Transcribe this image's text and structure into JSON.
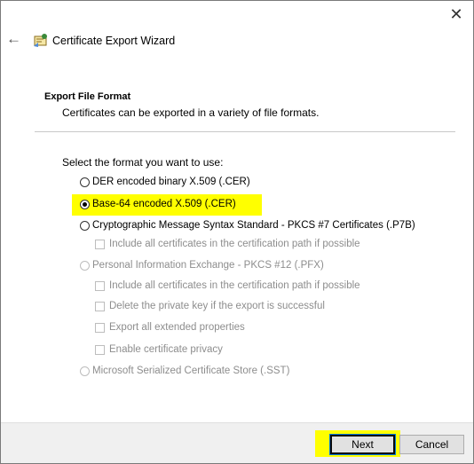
{
  "window": {
    "title": "Certificate Export Wizard"
  },
  "header": {
    "section_title": "Export File Format",
    "section_subtitle": "Certificates can be exported in a variety of file formats."
  },
  "form": {
    "prompt": "Select the format you want to use:",
    "options": [
      {
        "label": "DER encoded binary X.509 (.CER)",
        "type": "radio",
        "checked": false,
        "enabled": true
      },
      {
        "label": "Base-64 encoded X.509 (.CER)",
        "type": "radio",
        "checked": true,
        "enabled": true
      },
      {
        "label": "Cryptographic Message Syntax Standard - PKCS #7 Certificates (.P7B)",
        "type": "radio",
        "checked": false,
        "enabled": true
      },
      {
        "label": "Include all certificates in the certification path if possible",
        "type": "checkbox",
        "checked": false,
        "enabled": false
      },
      {
        "label": "Personal Information Exchange - PKCS #12 (.PFX)",
        "type": "radio",
        "checked": false,
        "enabled": false
      },
      {
        "label": "Include all certificates in the certification path if possible",
        "type": "checkbox",
        "checked": false,
        "enabled": false
      },
      {
        "label": "Delete the private key if the export is successful",
        "type": "checkbox",
        "checked": false,
        "enabled": false
      },
      {
        "label": "Export all extended properties",
        "type": "checkbox",
        "checked": false,
        "enabled": false
      },
      {
        "label": "Enable certificate privacy",
        "type": "checkbox",
        "checked": false,
        "enabled": false
      },
      {
        "label": "Microsoft Serialized Certificate Store (.SST)",
        "type": "radio",
        "checked": false,
        "enabled": false
      }
    ]
  },
  "buttons": {
    "next": "Next",
    "cancel": "Cancel"
  },
  "icons": {
    "close": "close-icon",
    "back": "back-arrow-icon",
    "wizard": "certificate-icon"
  },
  "colors": {
    "highlight": "#ffff00",
    "footer": "#f0f0f0",
    "focus": "#0078d7"
  }
}
